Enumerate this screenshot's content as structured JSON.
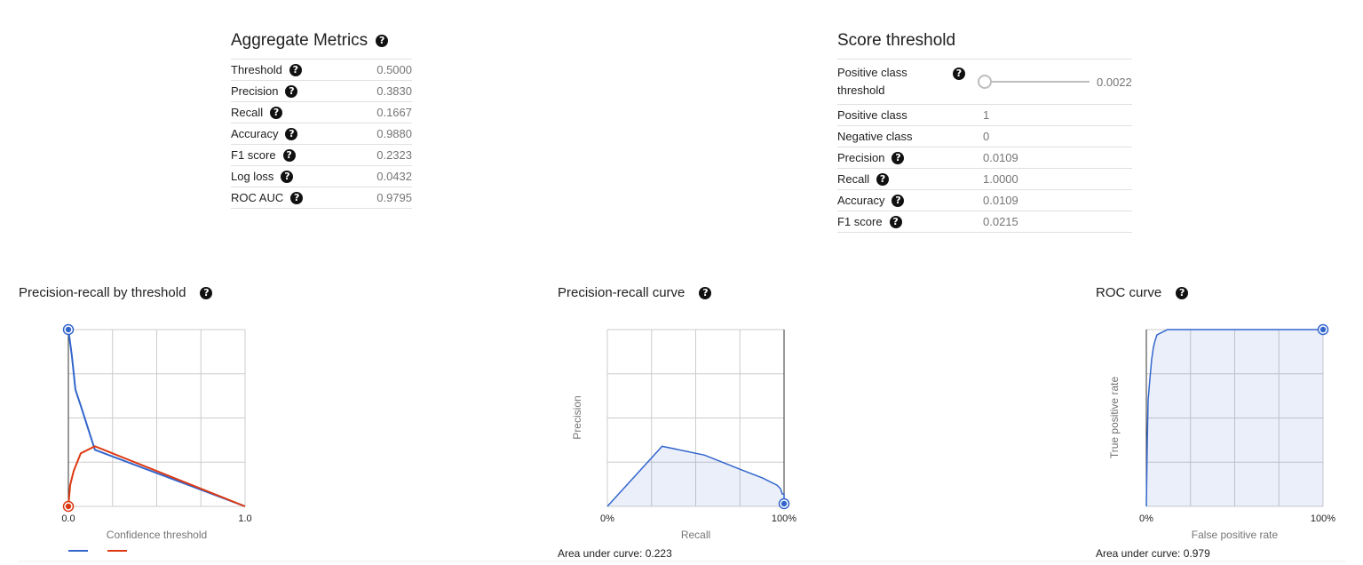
{
  "aggregate": {
    "title": "Aggregate Metrics",
    "rows": [
      {
        "label": "Threshold",
        "value": "0.5000"
      },
      {
        "label": "Precision",
        "value": "0.3830"
      },
      {
        "label": "Recall",
        "value": "0.1667"
      },
      {
        "label": "Accuracy",
        "value": "0.9880"
      },
      {
        "label": "F1 score",
        "value": "0.2323"
      },
      {
        "label": "Log loss",
        "value": "0.0432"
      },
      {
        "label": "ROC AUC",
        "value": "0.9795"
      }
    ]
  },
  "score_threshold": {
    "title": "Score threshold",
    "threshold_label": "Positive class threshold",
    "threshold_value": "0.0022",
    "threshold_fraction": 0.0022,
    "rows": [
      {
        "label": "Positive class",
        "value": "1"
      },
      {
        "label": "Negative class",
        "value": "0"
      },
      {
        "label": "Precision",
        "value": "0.0109"
      },
      {
        "label": "Recall",
        "value": "1.0000"
      },
      {
        "label": "Accuracy",
        "value": "0.0109"
      },
      {
        "label": "F1 score",
        "value": "0.0215"
      }
    ]
  },
  "chart_data": [
    {
      "title": "Precision-recall by threshold",
      "type": "line",
      "xlabel": "Confidence threshold",
      "ylabel": "",
      "xlim": [
        0,
        1
      ],
      "ylim": [
        0,
        1
      ],
      "xtick_labels": [
        "0.0",
        "1.0"
      ],
      "grid": true,
      "legend": "bottom",
      "series": [
        {
          "color": "#3366cc",
          "x": [
            0,
            0.02,
            0.04,
            0.07,
            0.15,
            1.0
          ],
          "y": [
            1.0,
            0.85,
            0.66,
            0.57,
            0.32,
            0.0
          ]
        },
        {
          "color": "#dc3912",
          "x": [
            0,
            0.01,
            0.03,
            0.07,
            0.15,
            1.0
          ],
          "y": [
            0.0,
            0.12,
            0.2,
            0.3,
            0.34,
            0.0
          ]
        }
      ]
    },
    {
      "title": "Precision-recall curve",
      "type": "area",
      "xlabel": "Recall",
      "ylabel": "Precision",
      "xlim": [
        0,
        100
      ],
      "ylim": [
        0,
        1
      ],
      "xtick_labels": [
        "0%",
        "100%"
      ],
      "grid": true,
      "x": [
        0,
        31,
        55,
        70,
        75,
        88,
        96,
        98,
        99,
        100,
        100
      ],
      "y": [
        0.0,
        0.34,
        0.29,
        0.23,
        0.21,
        0.16,
        0.12,
        0.1,
        0.07,
        0.07,
        0.01
      ],
      "auc_label": "Area under curve: 0.223"
    },
    {
      "title": "ROC curve",
      "type": "area",
      "xlabel": "False positive rate",
      "ylabel": "True positive rate",
      "xlim": [
        0,
        100
      ],
      "ylim": [
        0,
        1
      ],
      "xtick_labels": [
        "0%",
        "100%"
      ],
      "grid": true,
      "x": [
        0,
        0.5,
        1,
        2,
        3,
        4,
        5,
        6,
        8,
        12,
        100
      ],
      "y": [
        0.0,
        0.35,
        0.6,
        0.72,
        0.83,
        0.9,
        0.94,
        0.97,
        0.98,
        1.0,
        1.0
      ],
      "auc_label": "Area under curve: 0.979"
    }
  ]
}
